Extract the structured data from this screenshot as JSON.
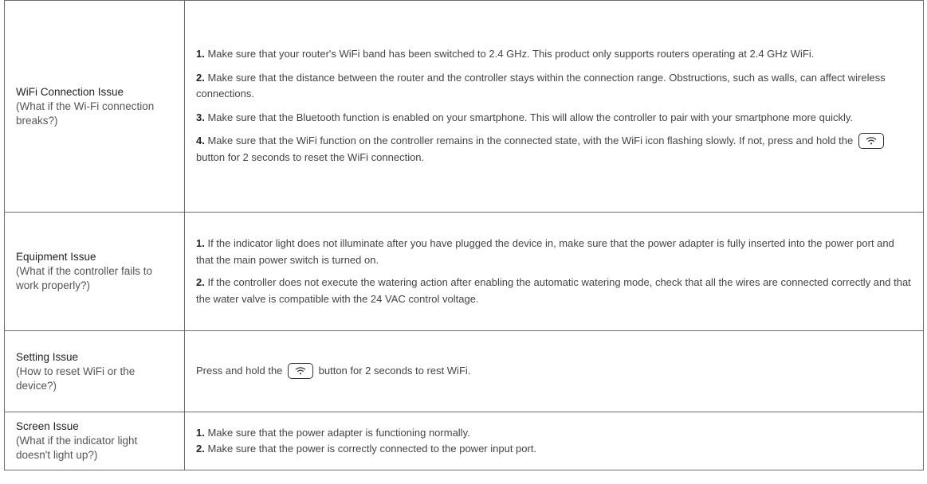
{
  "rows": [
    {
      "issue_title": "WiFi Connection Issue",
      "issue_question": "(What if the Wi-Fi connection breaks?)",
      "items": [
        {
          "num": "1.",
          "text": " Make sure that your router's WiFi band has been switched to 2.4 GHz. This product only supports routers operating at 2.4 GHz WiFi."
        },
        {
          "num": "2.",
          "text": " Make sure that the distance between the router and the controller stays within the connection range. Obstructions, such as walls, can affect wireless connections."
        },
        {
          "num": "3.",
          "text": " Make sure that the Bluetooth function is enabled on your smartphone. This will allow the controller to pair with your smartphone more quickly."
        },
        {
          "num": "4.",
          "text_before": " Make sure that the WiFi function on the controller remains in the connected state, with the WiFi icon flashing slowly. If not, press and hold the ",
          "text_after": " button for 2 seconds to reset the WiFi connection."
        }
      ]
    },
    {
      "issue_title": "Equipment Issue",
      "issue_question": "(What if the controller fails to work properly?)",
      "items": [
        {
          "num": "1.",
          "text": " If the indicator light does not illuminate after you have plugged the device in, make sure that the power adapter is fully inserted into the power port and that the main power switch is turned on."
        },
        {
          "num": "2.",
          "text": " If the controller does not execute the watering action after enabling the automatic watering mode, check that all the wires are connected correctly and that the water valve is compatible with the 24 VAC control voltage."
        }
      ]
    },
    {
      "issue_title": "Setting Issue",
      "issue_question": "(How to reset WiFi or the device?)",
      "text_before": "Press and hold the ",
      "text_after": " button for 2 seconds to rest WiFi."
    },
    {
      "issue_title": "Screen Issue",
      "issue_question": "(What if the indicator light doesn't light up?)",
      "items": [
        {
          "num": "1.",
          "text": " Make sure that the power adapter is functioning normally."
        },
        {
          "num": "2.",
          "text": " Make sure that the power is correctly connected to the power input port."
        }
      ]
    }
  ]
}
